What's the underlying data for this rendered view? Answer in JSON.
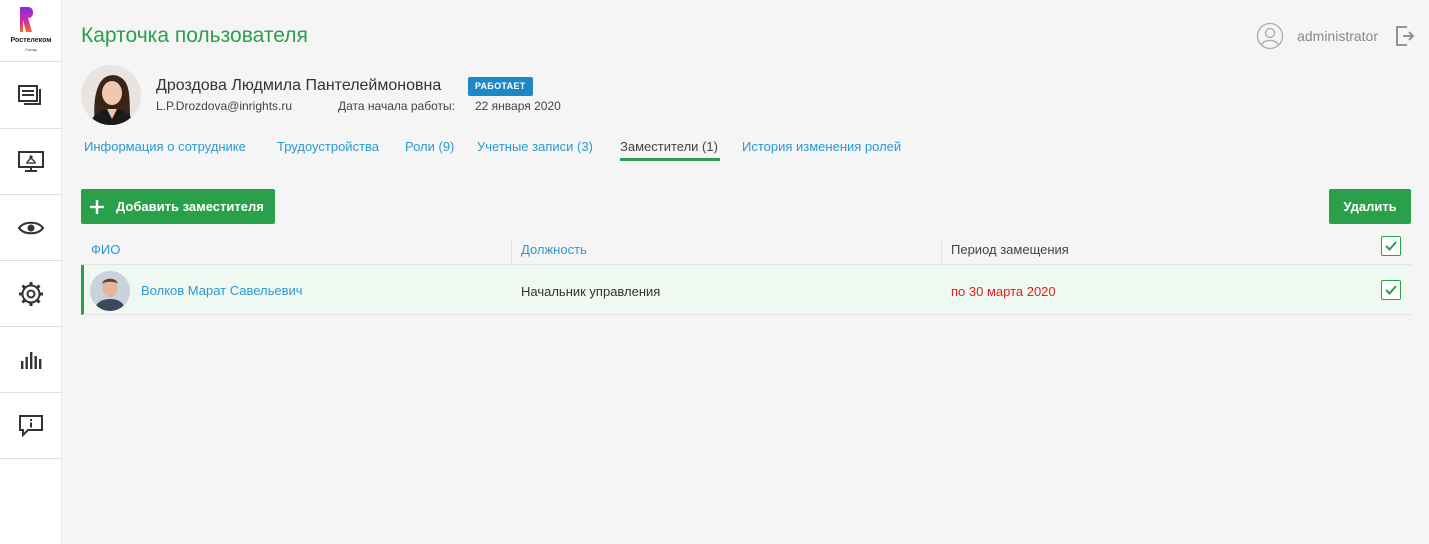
{
  "brand": {
    "name": "Ростелеком",
    "sub": "Солар",
    "color": "#7b2fd6"
  },
  "sidebar": {
    "items": [
      {
        "icon": "documents-icon"
      },
      {
        "icon": "monitor-network-icon"
      },
      {
        "icon": "eye-icon"
      },
      {
        "icon": "gear-icon"
      },
      {
        "icon": "bar-chart-icon"
      },
      {
        "icon": "info-message-icon"
      }
    ]
  },
  "header": {
    "title": "Карточка пользователя",
    "username": "administrator"
  },
  "profile": {
    "full_name": "Дроздова Людмила Пантелеймоновна",
    "status": "РАБОТАЕТ",
    "email": "L.P.Drozdova@inrights.ru",
    "start_date_label": "Дата начала работы:",
    "start_date": "22 января 2020"
  },
  "tabs": [
    {
      "label": "Информация о сотруднике"
    },
    {
      "label": "Трудоустройства"
    },
    {
      "label": "Роли (9)"
    },
    {
      "label": "Учетные записи (3)"
    },
    {
      "label": "Заместители (1)",
      "active": true
    },
    {
      "label": "История изменения ролей"
    }
  ],
  "actions": {
    "add_label": "Добавить заместителя",
    "delete_label": "Удалить"
  },
  "table": {
    "columns": [
      "ФИО",
      "Должность",
      "Период замещения"
    ],
    "rows": [
      {
        "name": "Волков Марат Савельевич",
        "position": "Начальник управления",
        "period": "по 30 марта 2020",
        "checked": true
      }
    ]
  },
  "colors": {
    "accent": "#2ba04a",
    "link": "#2a9ad1",
    "badge": "#1e88c7",
    "period": "#e02020"
  }
}
